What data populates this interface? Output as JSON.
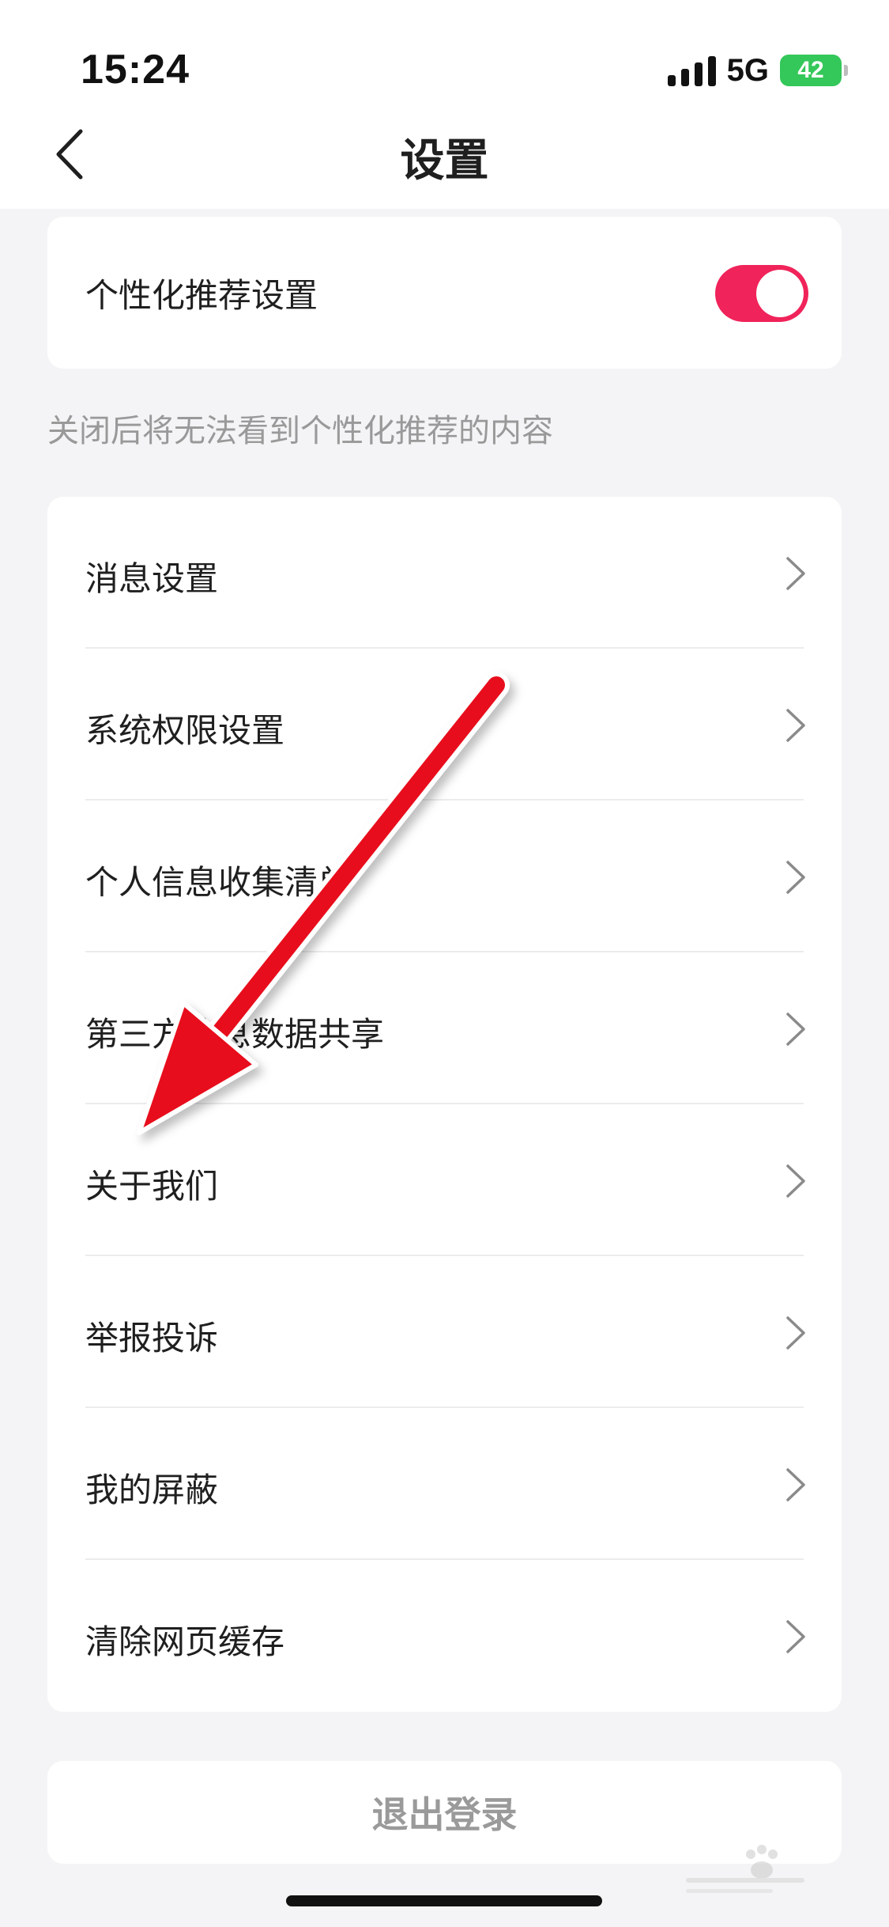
{
  "status_bar": {
    "time": "15:24",
    "network": "5G",
    "battery": "42"
  },
  "header": {
    "title": "设置",
    "back_icon": "chevron-left-icon"
  },
  "personalization": {
    "label": "个性化推荐设置",
    "toggle_on": true,
    "toggle_color": "#f0235a",
    "hint": "关闭后将无法看到个性化推荐的内容"
  },
  "menu": {
    "items": [
      {
        "label": "消息设置"
      },
      {
        "label": "系统权限设置"
      },
      {
        "label": "个人信息收集清单"
      },
      {
        "label": "第三方信息数据共享"
      },
      {
        "label": "关于我们"
      },
      {
        "label": "举报投诉"
      },
      {
        "label": "我的屏蔽"
      },
      {
        "label": "清除网页缓存"
      }
    ],
    "chevron_icon": "chevron-right-icon"
  },
  "logout": {
    "label": "退出登录"
  },
  "annotation": {
    "arrow_color": "#e8101a",
    "target": "关于我们"
  }
}
